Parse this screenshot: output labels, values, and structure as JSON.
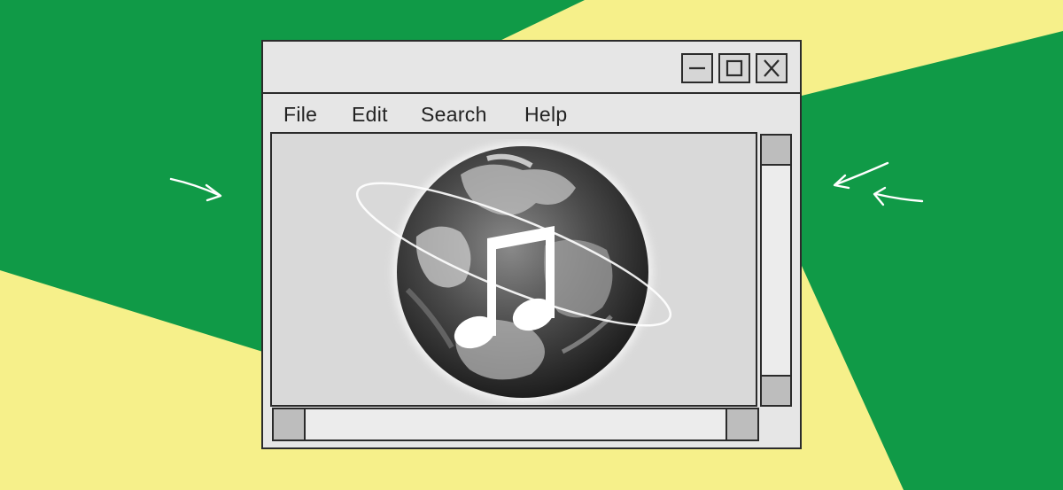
{
  "window": {
    "controls": {
      "minimize_icon": "minimize-icon",
      "maximize_icon": "maximize-icon",
      "close_icon": "close-icon"
    }
  },
  "menu": {
    "items": [
      {
        "label": "File"
      },
      {
        "label": "Edit"
      },
      {
        "label": "Search"
      },
      {
        "label": "Help"
      }
    ]
  },
  "content": {
    "illustration_icons": [
      "globe-icon",
      "music-note-icon",
      "orbit-ring-icon"
    ]
  },
  "colors": {
    "green": "#109a47",
    "yellow": "#f6f08a",
    "window_bg": "#e6e6e6",
    "border": "#2b2b2b",
    "scroll_button": "#bdbdbd"
  }
}
